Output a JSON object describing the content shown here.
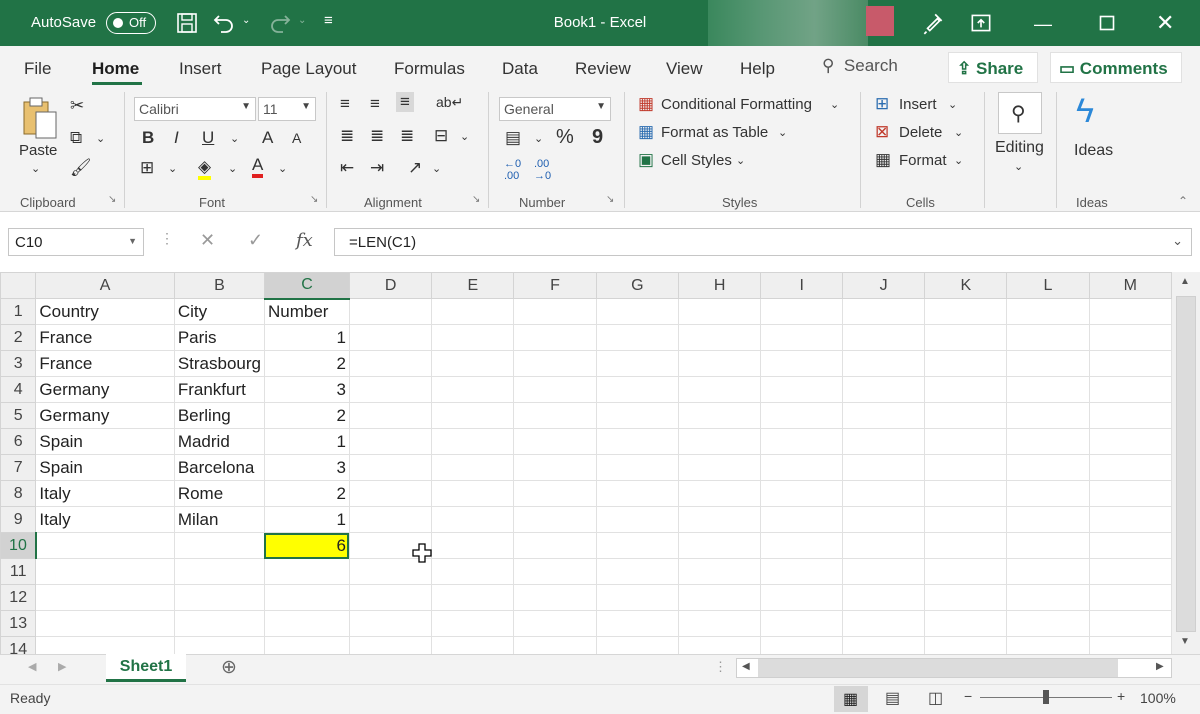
{
  "titlebar": {
    "autosave_label": "AutoSave",
    "autosave_state": "Off",
    "window_title": "Book1  -  Excel",
    "accent": "#217346"
  },
  "tabs": [
    "File",
    "Home",
    "Insert",
    "Page Layout",
    "Formulas",
    "Data",
    "Review",
    "View",
    "Help"
  ],
  "search_label": "Search",
  "share_label": "Share",
  "comments_label": "Comments",
  "ribbon": {
    "clipboard": {
      "paste": "Paste",
      "label": "Clipboard"
    },
    "font": {
      "name": "Calibri",
      "size": "11",
      "bold": "B",
      "italic": "I",
      "underline": "U",
      "grow": "A",
      "shrink": "A",
      "color": "A",
      "label": "Font"
    },
    "alignment": {
      "label": "Alignment"
    },
    "number": {
      "format": "General",
      "percent": "%",
      "comma": "9",
      "label": "Number"
    },
    "styles": {
      "conditional": "Conditional Formatting",
      "table": "Format as Table",
      "cell_styles": "Cell Styles",
      "label": "Styles"
    },
    "cells": {
      "insert": "Insert",
      "delete": "Delete",
      "format": "Format",
      "label": "Cells"
    },
    "editing": {
      "label": "Editing"
    },
    "ideas": {
      "button": "Ideas",
      "label": "Ideas"
    }
  },
  "formula_bar": {
    "name_box": "C10",
    "fx": "fx",
    "formula": "=LEN(C1)"
  },
  "columns": [
    "A",
    "B",
    "C",
    "D",
    "E",
    "F",
    "G",
    "H",
    "I",
    "J",
    "K",
    "L",
    "M"
  ],
  "rows": [
    {
      "n": "1",
      "a": "Country",
      "b": "City",
      "c": "Number"
    },
    {
      "n": "2",
      "a": "France",
      "b": "Paris",
      "c": "1"
    },
    {
      "n": "3",
      "a": "France",
      "b": "Strasbourg",
      "c": "2"
    },
    {
      "n": "4",
      "a": "Germany",
      "b": "Frankfurt",
      "c": "3"
    },
    {
      "n": "5",
      "a": "Germany",
      "b": "Berling",
      "c": "2"
    },
    {
      "n": "6",
      "a": "Spain",
      "b": "Madrid",
      "c": "1"
    },
    {
      "n": "7",
      "a": "Spain",
      "b": "Barcelona",
      "c": "3"
    },
    {
      "n": "8",
      "a": "Italy",
      "b": "Rome",
      "c": "2"
    },
    {
      "n": "9",
      "a": "Italy",
      "b": "Milan",
      "c": "1"
    },
    {
      "n": "10",
      "a": "",
      "b": "",
      "c": "6"
    },
    {
      "n": "11",
      "a": "",
      "b": "",
      "c": ""
    },
    {
      "n": "12",
      "a": "",
      "b": "",
      "c": ""
    },
    {
      "n": "13",
      "a": "",
      "b": "",
      "c": ""
    },
    {
      "n": "14",
      "a": "",
      "b": "",
      "c": ""
    }
  ],
  "selected_cell_color": "#ffff00",
  "sheet_tab": "Sheet1",
  "status": {
    "text": "Ready",
    "zoom": "100%"
  }
}
